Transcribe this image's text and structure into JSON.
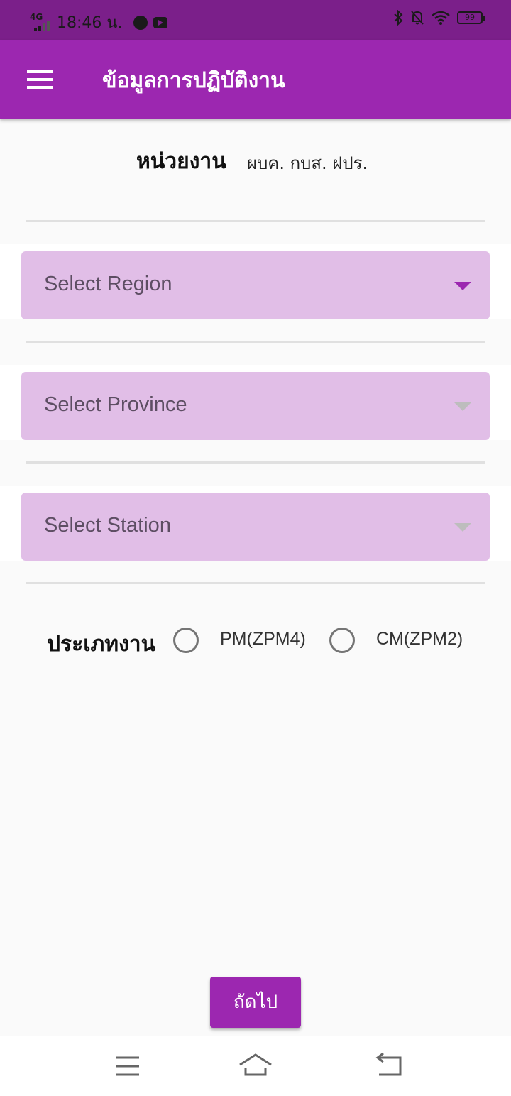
{
  "status_bar": {
    "network": "4G",
    "time": "18:46 น.",
    "battery": "99"
  },
  "app_bar": {
    "title": "ข้อมูลการปฏิบัติงาน"
  },
  "unit": {
    "label": "หน่วยงาน",
    "value": "ผบค. กบส. ฝปร."
  },
  "dropdowns": {
    "region": {
      "placeholder": "Select Region",
      "enabled": true
    },
    "province": {
      "placeholder": "Select Province",
      "enabled": false
    },
    "station": {
      "placeholder": "Select Station",
      "enabled": false
    }
  },
  "job_type": {
    "label": "ประเภทงาน",
    "options": [
      "PM(ZPM4)",
      "CM(ZPM2)"
    ],
    "selected": null
  },
  "next_button": {
    "label": "ถัดไป"
  },
  "colors": {
    "status_bar": "#7b1f8a",
    "primary": "#9c27b0",
    "dropdown_bg": "#e1bee7",
    "background": "#fafafa"
  },
  "icons": {
    "menu": "hamburger-icon",
    "nav_recent": "menu-lines-icon",
    "nav_home": "home-icon",
    "nav_back": "back-icon"
  }
}
